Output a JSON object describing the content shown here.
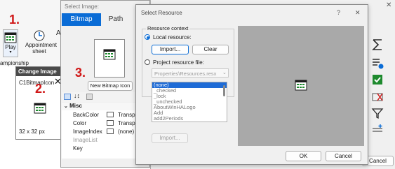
{
  "step_labels": {
    "one": "1.",
    "two": "2.",
    "three": "3."
  },
  "ribbon": {
    "play_label": "Play",
    "appointment_label": "Appointment",
    "appointment_label2": "sheet",
    "group_label": "ampionship"
  },
  "change_image": {
    "title": "Change Image",
    "icon_name": "C1BitmapIcon",
    "size": "32 x 32 px"
  },
  "select_image": {
    "title": "Select Image:",
    "tabs": [
      "Bitmap",
      "Path"
    ],
    "new_bitmap_button": "New Bitmap Icon",
    "section_misc": "Misc",
    "props": [
      {
        "name": "BackColor",
        "value": "Transpa"
      },
      {
        "name": "Color",
        "value": "Transpa"
      },
      {
        "name": "ImageIndex",
        "value": "(none)"
      },
      {
        "name": "ImageList",
        "value": ""
      },
      {
        "name": "Key",
        "value": ""
      }
    ]
  },
  "select_resource": {
    "title": "Select Resource",
    "help": "?",
    "close": "✕",
    "group_label": "Resource context",
    "local_resource_label": "Local resource:",
    "import_button": "Import...",
    "clear_button": "Clear",
    "project_resource_label": "Project resource file:",
    "project_file_value": "Properties\\Resources.resx",
    "list_items": [
      "(none)",
      "_checked",
      "_lock",
      "_unchecked",
      "AboutWinHALogo",
      "Add",
      "add2Periods"
    ],
    "import_disabled_button": "Import...",
    "ok_button": "OK",
    "cancel_button": "Cancel"
  },
  "right_panel": {
    "cancel_label": "Cancel"
  },
  "colors": {
    "accent": "#0a6cd6",
    "step_red": "#d01818",
    "green_check": "#1e8a2e"
  }
}
